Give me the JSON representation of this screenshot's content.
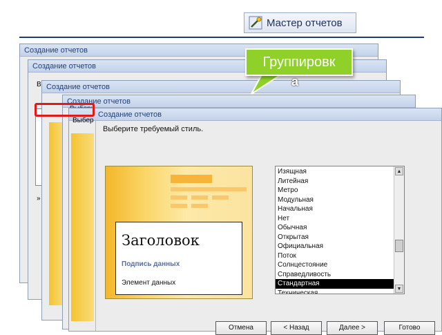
{
  "toolbar": {
    "wizard_button_label": "Мастер отчетов",
    "wizard_icon": "wizard-wand-icon"
  },
  "windows": {
    "title": "Создание отчетов",
    "bg_label_2": "В",
    "bg_label_4": "Выбери",
    "bg_label_5": "Выбер",
    "bg_label_side": "»"
  },
  "callout": {
    "text": "Группировк",
    "text_tail": "а",
    "color": "#8fd129"
  },
  "style_dialog": {
    "prompt": "Выберите требуемый стиль.",
    "preview": {
      "title": "Заголовок",
      "subtitle": "Подпись данных",
      "element": "Элемент данных"
    },
    "styles": [
      "Изящная",
      "Литейная",
      "Метро",
      "Модульная",
      "Начальная",
      "Нет",
      "Обычная",
      "Открытая",
      "Официальная",
      "Поток",
      "Солнцестояние",
      "Справедливость",
      "Стандартная",
      "Техническая"
    ],
    "selected_style": "Стандартная",
    "buttons": {
      "cancel": "Отмена",
      "back": "< Назад",
      "next": "Далее >",
      "finish": "Готово"
    }
  },
  "colors": {
    "title_bar": "#c4d3ea",
    "accent": "#1f3a78",
    "highlight": "#e11919",
    "preview_yellow": "#f4c430"
  }
}
